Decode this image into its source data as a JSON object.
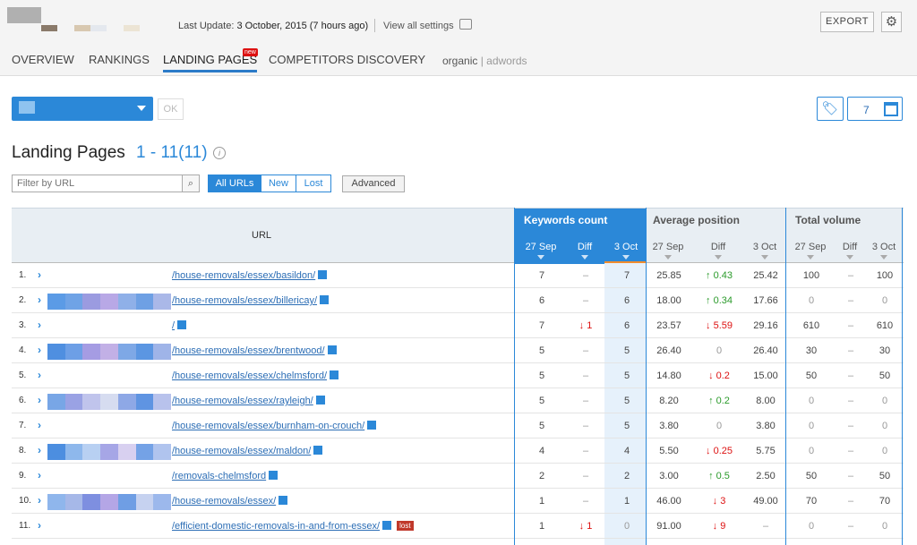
{
  "header": {
    "last_update_label": "Last Update:",
    "last_update_value": "3 October, 2015 (7 hours ago)",
    "view_settings": "View all settings",
    "export_label": "EXPORT"
  },
  "tabs": [
    {
      "label": "OVERVIEW"
    },
    {
      "label": "RANKINGS"
    },
    {
      "label": "LANDING PAGES",
      "badge": "new"
    },
    {
      "label": "COMPETITORS DISCOVERY"
    }
  ],
  "source_toggle": {
    "organic": "organic",
    "sep": "|",
    "adwords": "adwords"
  },
  "toolbar": {
    "ok_label": "OK",
    "calendar_value": "7"
  },
  "page": {
    "title": "Landing Pages",
    "range": "1 - 11(11)",
    "info": "i"
  },
  "filter": {
    "placeholder": "Filter by URL",
    "buttons": [
      "All URLs",
      "New",
      "Lost"
    ],
    "advanced": "Advanced"
  },
  "table": {
    "url_header": "URL",
    "groups": [
      "Keywords count",
      "Average position",
      "Total volume"
    ],
    "sub": [
      "27 Sep",
      "Diff",
      "3 Oct"
    ],
    "rows": [
      {
        "n": "1.",
        "url": "/house-removals/essex/basildon/",
        "kc": [
          "7",
          "–",
          "7"
        ],
        "ap": [
          "25.85",
          "↑ 0.43",
          "25.42"
        ],
        "apd": "up",
        "tv": [
          "100",
          "–",
          "100"
        ]
      },
      {
        "n": "2.",
        "url": "/house-removals/essex/billericay/",
        "kc": [
          "6",
          "–",
          "6"
        ],
        "ap": [
          "18.00",
          "↑ 0.34",
          "17.66"
        ],
        "apd": "up",
        "tv": [
          "0",
          "–",
          "0"
        ]
      },
      {
        "n": "3.",
        "url": "/",
        "kc": [
          "7",
          "↓ 1",
          "6"
        ],
        "kcd": "dn",
        "ap": [
          "23.57",
          "↓ 5.59",
          "29.16"
        ],
        "apd": "dn",
        "tv": [
          "610",
          "–",
          "610"
        ]
      },
      {
        "n": "4.",
        "url": "/house-removals/essex/brentwood/",
        "kc": [
          "5",
          "–",
          "5"
        ],
        "ap": [
          "26.40",
          "0",
          "26.40"
        ],
        "tv": [
          "30",
          "–",
          "30"
        ]
      },
      {
        "n": "5.",
        "url": "/house-removals/essex/chelmsford/",
        "kc": [
          "5",
          "–",
          "5"
        ],
        "ap": [
          "14.80",
          "↓ 0.2",
          "15.00"
        ],
        "apd": "dn",
        "tv": [
          "50",
          "–",
          "50"
        ]
      },
      {
        "n": "6.",
        "url": "/house-removals/essex/rayleigh/",
        "kc": [
          "5",
          "–",
          "5"
        ],
        "ap": [
          "8.20",
          "↑ 0.2",
          "8.00"
        ],
        "apd": "up",
        "tv": [
          "0",
          "–",
          "0"
        ]
      },
      {
        "n": "7.",
        "url": "/house-removals/essex/burnham-on-crouch/",
        "kc": [
          "5",
          "–",
          "5"
        ],
        "ap": [
          "3.80",
          "0",
          "3.80"
        ],
        "tv": [
          "0",
          "–",
          "0"
        ]
      },
      {
        "n": "8.",
        "url": "/house-removals/essex/maldon/",
        "kc": [
          "4",
          "–",
          "4"
        ],
        "ap": [
          "5.50",
          "↓ 0.25",
          "5.75"
        ],
        "apd": "dn",
        "tv": [
          "0",
          "–",
          "0"
        ]
      },
      {
        "n": "9.",
        "url": "/removals-chelmsford",
        "kc": [
          "2",
          "–",
          "2"
        ],
        "ap": [
          "3.00",
          "↑ 0.5",
          "2.50"
        ],
        "apd": "up",
        "tv": [
          "50",
          "–",
          "50"
        ]
      },
      {
        "n": "10.",
        "url": "/house-removals/essex/",
        "kc": [
          "1",
          "–",
          "1"
        ],
        "ap": [
          "46.00",
          "↓ 3",
          "49.00"
        ],
        "apd": "dn",
        "tv": [
          "70",
          "–",
          "70"
        ]
      },
      {
        "n": "11.",
        "url": "/efficient-domestic-removals-in-and-from-essex/",
        "kc": [
          "1",
          "↓ 1",
          "0"
        ],
        "kcd": "dn",
        "ap": [
          "91.00",
          "↓ 9",
          "–"
        ],
        "apd": "dn",
        "tv": [
          "0",
          "–",
          "0"
        ],
        "lost": "lost"
      }
    ]
  }
}
